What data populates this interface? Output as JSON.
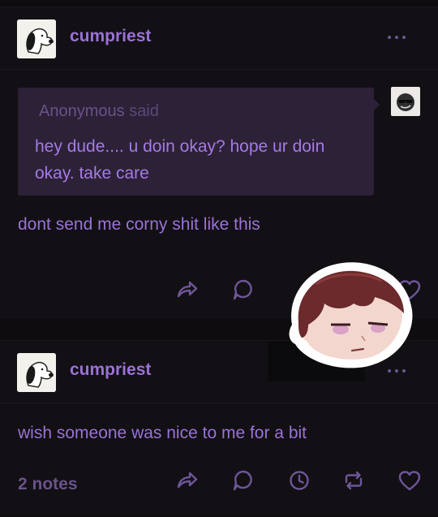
{
  "posts": [
    {
      "username": "cumpriest",
      "ask": {
        "asker": "Anonymous",
        "said": "said",
        "text": "hey dude.... u doin okay? hope ur doin okay. take care"
      },
      "reply": "dont send me corny shit like this"
    },
    {
      "username": "cumpriest",
      "body": "wish someone was nice to me for a bit",
      "notes": "2 notes"
    }
  ],
  "icons": {
    "more": "ellipsis-icon",
    "share": "share-icon",
    "reply": "reply-icon",
    "history": "clock-icon",
    "reblog": "reblog-icon",
    "like": "heart-icon"
  },
  "colors": {
    "background": "#121014",
    "accent": "#9b72d6",
    "ask_bg": "#2c2137"
  }
}
